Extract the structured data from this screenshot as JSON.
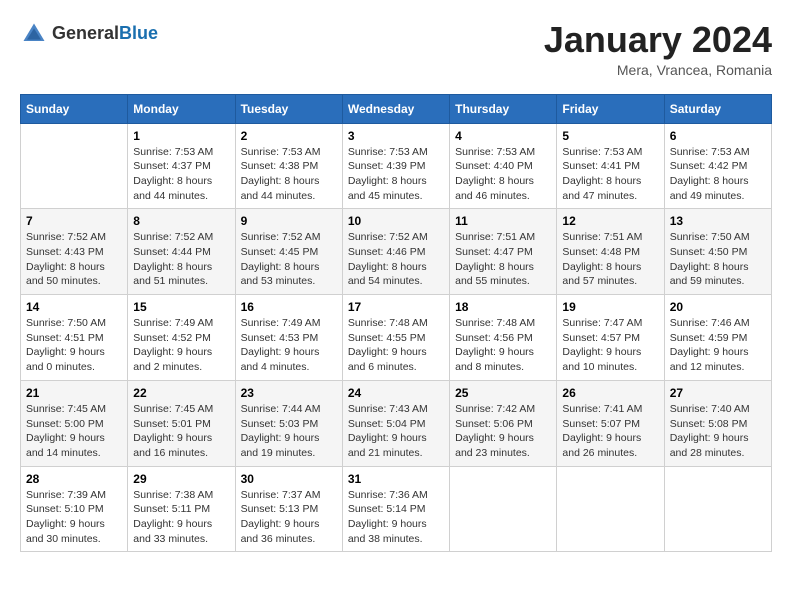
{
  "header": {
    "logo_general": "General",
    "logo_blue": "Blue",
    "month_title": "January 2024",
    "location": "Mera, Vrancea, Romania"
  },
  "weekdays": [
    "Sunday",
    "Monday",
    "Tuesday",
    "Wednesday",
    "Thursday",
    "Friday",
    "Saturday"
  ],
  "weeks": [
    [
      {
        "day": "",
        "sunrise": "",
        "sunset": "",
        "daylight": ""
      },
      {
        "day": "1",
        "sunrise": "Sunrise: 7:53 AM",
        "sunset": "Sunset: 4:37 PM",
        "daylight": "Daylight: 8 hours and 44 minutes."
      },
      {
        "day": "2",
        "sunrise": "Sunrise: 7:53 AM",
        "sunset": "Sunset: 4:38 PM",
        "daylight": "Daylight: 8 hours and 44 minutes."
      },
      {
        "day": "3",
        "sunrise": "Sunrise: 7:53 AM",
        "sunset": "Sunset: 4:39 PM",
        "daylight": "Daylight: 8 hours and 45 minutes."
      },
      {
        "day": "4",
        "sunrise": "Sunrise: 7:53 AM",
        "sunset": "Sunset: 4:40 PM",
        "daylight": "Daylight: 8 hours and 46 minutes."
      },
      {
        "day": "5",
        "sunrise": "Sunrise: 7:53 AM",
        "sunset": "Sunset: 4:41 PM",
        "daylight": "Daylight: 8 hours and 47 minutes."
      },
      {
        "day": "6",
        "sunrise": "Sunrise: 7:53 AM",
        "sunset": "Sunset: 4:42 PM",
        "daylight": "Daylight: 8 hours and 49 minutes."
      }
    ],
    [
      {
        "day": "7",
        "sunrise": "Sunrise: 7:52 AM",
        "sunset": "Sunset: 4:43 PM",
        "daylight": "Daylight: 8 hours and 50 minutes."
      },
      {
        "day": "8",
        "sunrise": "Sunrise: 7:52 AM",
        "sunset": "Sunset: 4:44 PM",
        "daylight": "Daylight: 8 hours and 51 minutes."
      },
      {
        "day": "9",
        "sunrise": "Sunrise: 7:52 AM",
        "sunset": "Sunset: 4:45 PM",
        "daylight": "Daylight: 8 hours and 53 minutes."
      },
      {
        "day": "10",
        "sunrise": "Sunrise: 7:52 AM",
        "sunset": "Sunset: 4:46 PM",
        "daylight": "Daylight: 8 hours and 54 minutes."
      },
      {
        "day": "11",
        "sunrise": "Sunrise: 7:51 AM",
        "sunset": "Sunset: 4:47 PM",
        "daylight": "Daylight: 8 hours and 55 minutes."
      },
      {
        "day": "12",
        "sunrise": "Sunrise: 7:51 AM",
        "sunset": "Sunset: 4:48 PM",
        "daylight": "Daylight: 8 hours and 57 minutes."
      },
      {
        "day": "13",
        "sunrise": "Sunrise: 7:50 AM",
        "sunset": "Sunset: 4:50 PM",
        "daylight": "Daylight: 8 hours and 59 minutes."
      }
    ],
    [
      {
        "day": "14",
        "sunrise": "Sunrise: 7:50 AM",
        "sunset": "Sunset: 4:51 PM",
        "daylight": "Daylight: 9 hours and 0 minutes."
      },
      {
        "day": "15",
        "sunrise": "Sunrise: 7:49 AM",
        "sunset": "Sunset: 4:52 PM",
        "daylight": "Daylight: 9 hours and 2 minutes."
      },
      {
        "day": "16",
        "sunrise": "Sunrise: 7:49 AM",
        "sunset": "Sunset: 4:53 PM",
        "daylight": "Daylight: 9 hours and 4 minutes."
      },
      {
        "day": "17",
        "sunrise": "Sunrise: 7:48 AM",
        "sunset": "Sunset: 4:55 PM",
        "daylight": "Daylight: 9 hours and 6 minutes."
      },
      {
        "day": "18",
        "sunrise": "Sunrise: 7:48 AM",
        "sunset": "Sunset: 4:56 PM",
        "daylight": "Daylight: 9 hours and 8 minutes."
      },
      {
        "day": "19",
        "sunrise": "Sunrise: 7:47 AM",
        "sunset": "Sunset: 4:57 PM",
        "daylight": "Daylight: 9 hours and 10 minutes."
      },
      {
        "day": "20",
        "sunrise": "Sunrise: 7:46 AM",
        "sunset": "Sunset: 4:59 PM",
        "daylight": "Daylight: 9 hours and 12 minutes."
      }
    ],
    [
      {
        "day": "21",
        "sunrise": "Sunrise: 7:45 AM",
        "sunset": "Sunset: 5:00 PM",
        "daylight": "Daylight: 9 hours and 14 minutes."
      },
      {
        "day": "22",
        "sunrise": "Sunrise: 7:45 AM",
        "sunset": "Sunset: 5:01 PM",
        "daylight": "Daylight: 9 hours and 16 minutes."
      },
      {
        "day": "23",
        "sunrise": "Sunrise: 7:44 AM",
        "sunset": "Sunset: 5:03 PM",
        "daylight": "Daylight: 9 hours and 19 minutes."
      },
      {
        "day": "24",
        "sunrise": "Sunrise: 7:43 AM",
        "sunset": "Sunset: 5:04 PM",
        "daylight": "Daylight: 9 hours and 21 minutes."
      },
      {
        "day": "25",
        "sunrise": "Sunrise: 7:42 AM",
        "sunset": "Sunset: 5:06 PM",
        "daylight": "Daylight: 9 hours and 23 minutes."
      },
      {
        "day": "26",
        "sunrise": "Sunrise: 7:41 AM",
        "sunset": "Sunset: 5:07 PM",
        "daylight": "Daylight: 9 hours and 26 minutes."
      },
      {
        "day": "27",
        "sunrise": "Sunrise: 7:40 AM",
        "sunset": "Sunset: 5:08 PM",
        "daylight": "Daylight: 9 hours and 28 minutes."
      }
    ],
    [
      {
        "day": "28",
        "sunrise": "Sunrise: 7:39 AM",
        "sunset": "Sunset: 5:10 PM",
        "daylight": "Daylight: 9 hours and 30 minutes."
      },
      {
        "day": "29",
        "sunrise": "Sunrise: 7:38 AM",
        "sunset": "Sunset: 5:11 PM",
        "daylight": "Daylight: 9 hours and 33 minutes."
      },
      {
        "day": "30",
        "sunrise": "Sunrise: 7:37 AM",
        "sunset": "Sunset: 5:13 PM",
        "daylight": "Daylight: 9 hours and 36 minutes."
      },
      {
        "day": "31",
        "sunrise": "Sunrise: 7:36 AM",
        "sunset": "Sunset: 5:14 PM",
        "daylight": "Daylight: 9 hours and 38 minutes."
      },
      {
        "day": "",
        "sunrise": "",
        "sunset": "",
        "daylight": ""
      },
      {
        "day": "",
        "sunrise": "",
        "sunset": "",
        "daylight": ""
      },
      {
        "day": "",
        "sunrise": "",
        "sunset": "",
        "daylight": ""
      }
    ]
  ]
}
